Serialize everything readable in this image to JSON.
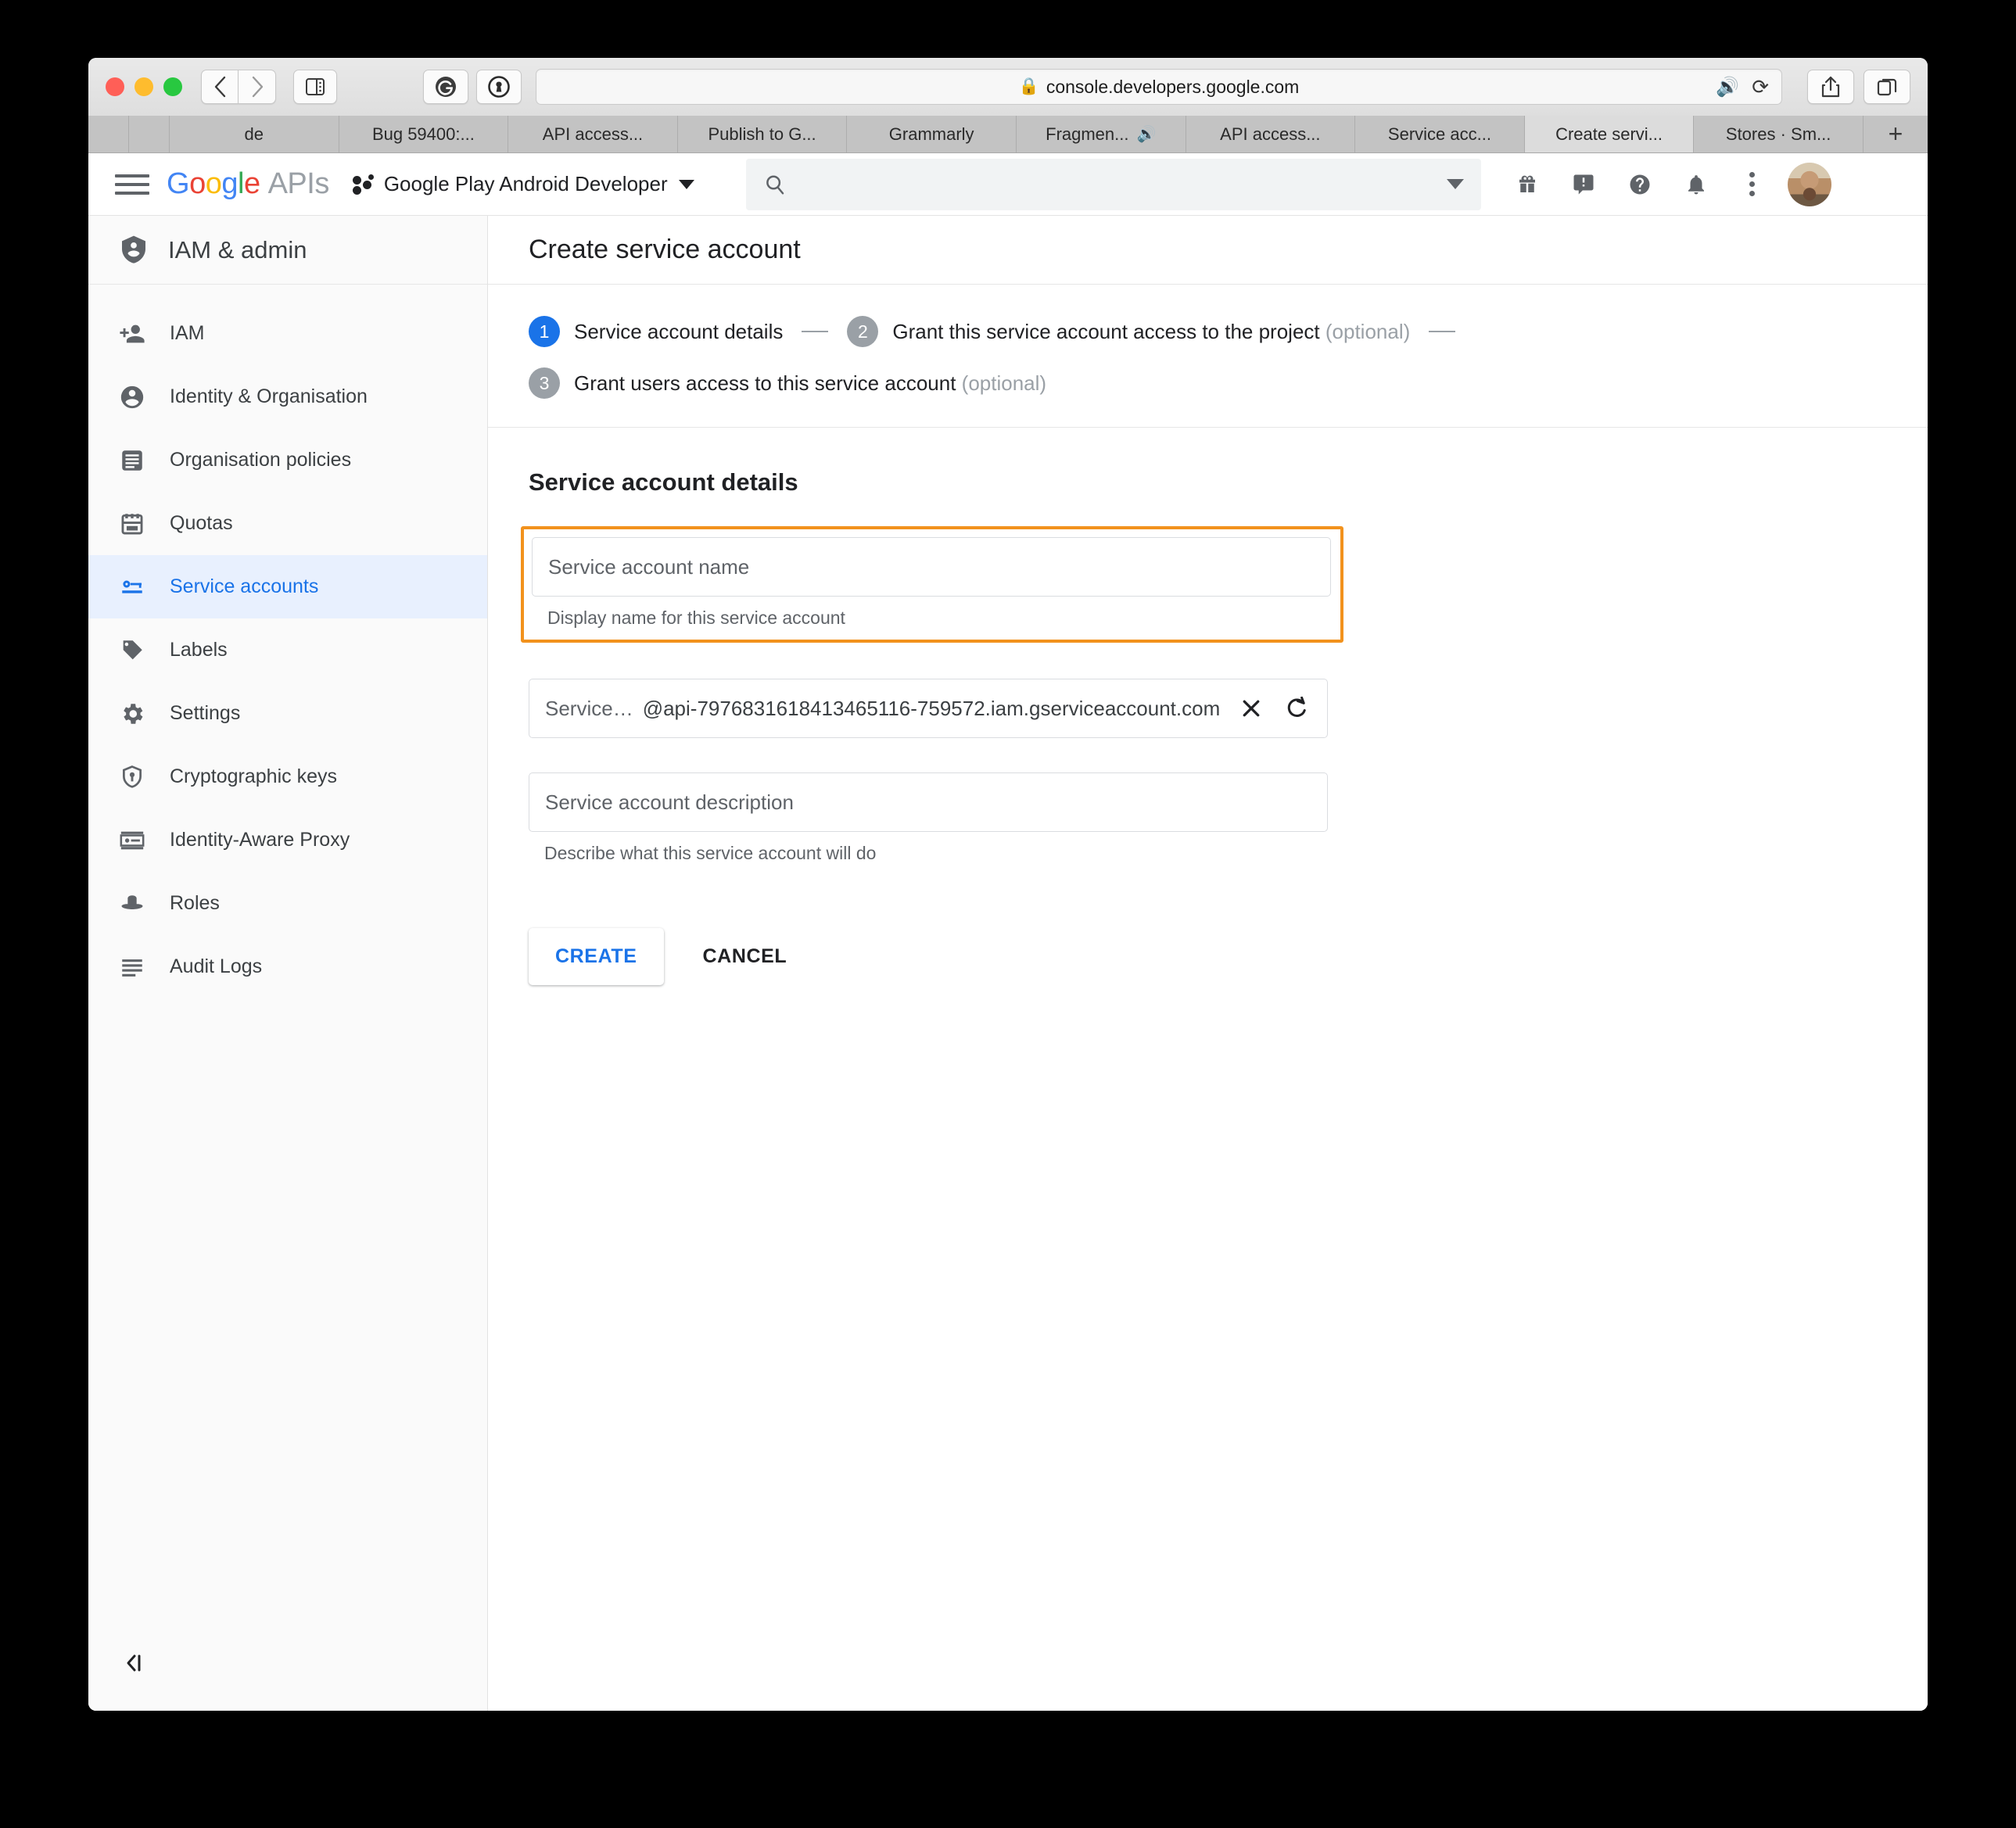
{
  "browser": {
    "url": "console.developers.google.com",
    "toolbar": {
      "back_icon": "back-chevron-icon",
      "forward_icon": "forward-chevron-icon",
      "sidebar_icon": "sidebar-toggle-icon",
      "grammarly_label": "G",
      "onepassword_label": "1",
      "share_icon": "share-icon",
      "tabs_overview_icon": "tabs-overview-icon",
      "audio_icon": "audio-playing-icon",
      "reload_icon": "reload-icon",
      "lock_icon": "lock-icon"
    },
    "tabs": [
      {
        "title": "de",
        "active": false,
        "audio": false
      },
      {
        "title": "Bug 59400:...",
        "active": false,
        "audio": false
      },
      {
        "title": "API access...",
        "active": false,
        "audio": false
      },
      {
        "title": "Publish to G...",
        "active": false,
        "audio": false
      },
      {
        "title": "Grammarly",
        "active": false,
        "audio": false
      },
      {
        "title": "Fragmen...",
        "active": false,
        "audio": true
      },
      {
        "title": "API access...",
        "active": false,
        "audio": false
      },
      {
        "title": "Service acc...",
        "active": false,
        "audio": false
      },
      {
        "title": "Create servi...",
        "active": true,
        "audio": false
      },
      {
        "title": "Stores · Sm...",
        "active": false,
        "audio": false
      }
    ],
    "new_tab_label": "+"
  },
  "header": {
    "menu_icon": "hamburger-menu-icon",
    "logo": {
      "g1": "G",
      "o1": "o",
      "o2": "o",
      "g2": "g",
      "l": "l",
      "e": "e",
      "apis": "APIs"
    },
    "project_name": "Google Play Android Developer",
    "search_placeholder": "",
    "icons": [
      "gift-icon",
      "feedback-icon",
      "help-icon",
      "notifications-icon",
      "more-vert-icon"
    ],
    "avatar_label": "account-avatar"
  },
  "sidebar": {
    "title": "IAM & admin",
    "title_icon": "shield-person-icon",
    "collapse_label": "◁|",
    "items": [
      {
        "label": "IAM",
        "icon": "person-add-icon",
        "active": false
      },
      {
        "label": "Identity & Organisation",
        "icon": "account-circle-icon",
        "active": false
      },
      {
        "label": "Organisation policies",
        "icon": "policy-list-icon",
        "active": false
      },
      {
        "label": "Quotas",
        "icon": "quotas-icon",
        "active": false
      },
      {
        "label": "Service accounts",
        "icon": "key-card-icon",
        "active": true
      },
      {
        "label": "Labels",
        "icon": "label-tag-icon",
        "active": false
      },
      {
        "label": "Settings",
        "icon": "gear-icon",
        "active": false
      },
      {
        "label": "Cryptographic keys",
        "icon": "shield-key-icon",
        "active": false
      },
      {
        "label": "Identity-Aware Proxy",
        "icon": "iap-icon",
        "active": false
      },
      {
        "label": "Roles",
        "icon": "hat-icon",
        "active": false
      },
      {
        "label": "Audit Logs",
        "icon": "audit-lines-icon",
        "active": false
      }
    ]
  },
  "main": {
    "page_title": "Create service account",
    "steps": [
      {
        "number": "1",
        "label": "Service account details",
        "optional": "",
        "current": true
      },
      {
        "number": "2",
        "label": "Grant this service account access to the project",
        "optional": "(optional)",
        "current": false
      },
      {
        "number": "3",
        "label": "Grant users access to this service account",
        "optional": "(optional)",
        "current": false
      }
    ],
    "form": {
      "heading": "Service account details",
      "name_field": {
        "value": "",
        "placeholder": "Service account name",
        "helper": "Display name for this service account",
        "highlighted": true,
        "highlight_color": "#f2921d"
      },
      "id_field": {
        "prefix": "Service…",
        "domain": "@api-7976831618413465116-759572.iam.gserviceaccount.com",
        "clear_icon": "close-x-icon",
        "refresh_icon": "refresh-icon"
      },
      "description_field": {
        "value": "",
        "placeholder": "Service account description",
        "helper": "Describe what this service account will do"
      },
      "create_label": "CREATE",
      "cancel_label": "CANCEL",
      "accent_color": "#1a73e8"
    }
  }
}
